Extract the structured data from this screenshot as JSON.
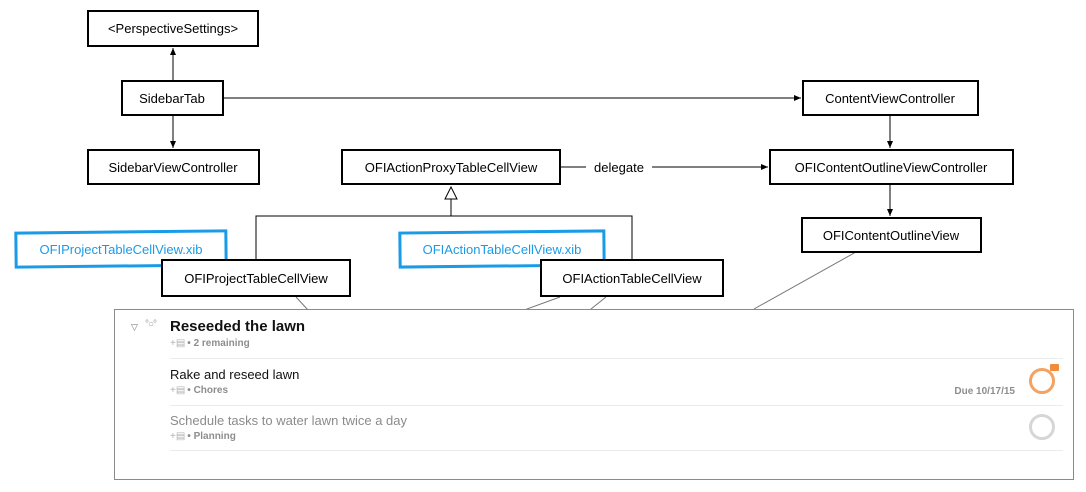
{
  "nodes": {
    "perspective_settings": "<PerspectiveSettings>",
    "sidebar_tab": "SidebarTab",
    "sidebar_view_controller": "SidebarViewController",
    "content_view_controller": "ContentViewController",
    "action_proxy_cell_view": "OFIActionProxyTableCellView",
    "content_outline_view_controller": "OFIContentOutlineViewController",
    "content_outline_view": "OFIContentOutlineView",
    "project_cell_view": "OFIProjectTableCellView",
    "action_cell_view": "OFIActionTableCellView",
    "project_xib": "OFIProjectTableCellView.xib",
    "action_xib": "OFIActionTableCellView.xib"
  },
  "edge_labels": {
    "delegate": "delegate"
  },
  "panel": {
    "project": {
      "title": "Reseeded the lawn",
      "meta": "• 2 remaining"
    },
    "actions": [
      {
        "title": "Rake and reseed lawn",
        "meta": "• Chores",
        "due": "Due 10/17/15"
      },
      {
        "title": "Schedule tasks to water lawn twice a day",
        "meta": "• Planning",
        "due": ""
      }
    ]
  },
  "colors": {
    "xib_accent": "#1a9be8",
    "due_circle": "#f4a261",
    "flag": "#f28c38",
    "inactive_circle": "#d6d6d6"
  },
  "icons": {
    "disclosure": "disclosure-triangle-icon",
    "project_type": "project-type-icon",
    "note": "note-icon",
    "status": "status-circle-icon",
    "flag": "flag-icon"
  }
}
